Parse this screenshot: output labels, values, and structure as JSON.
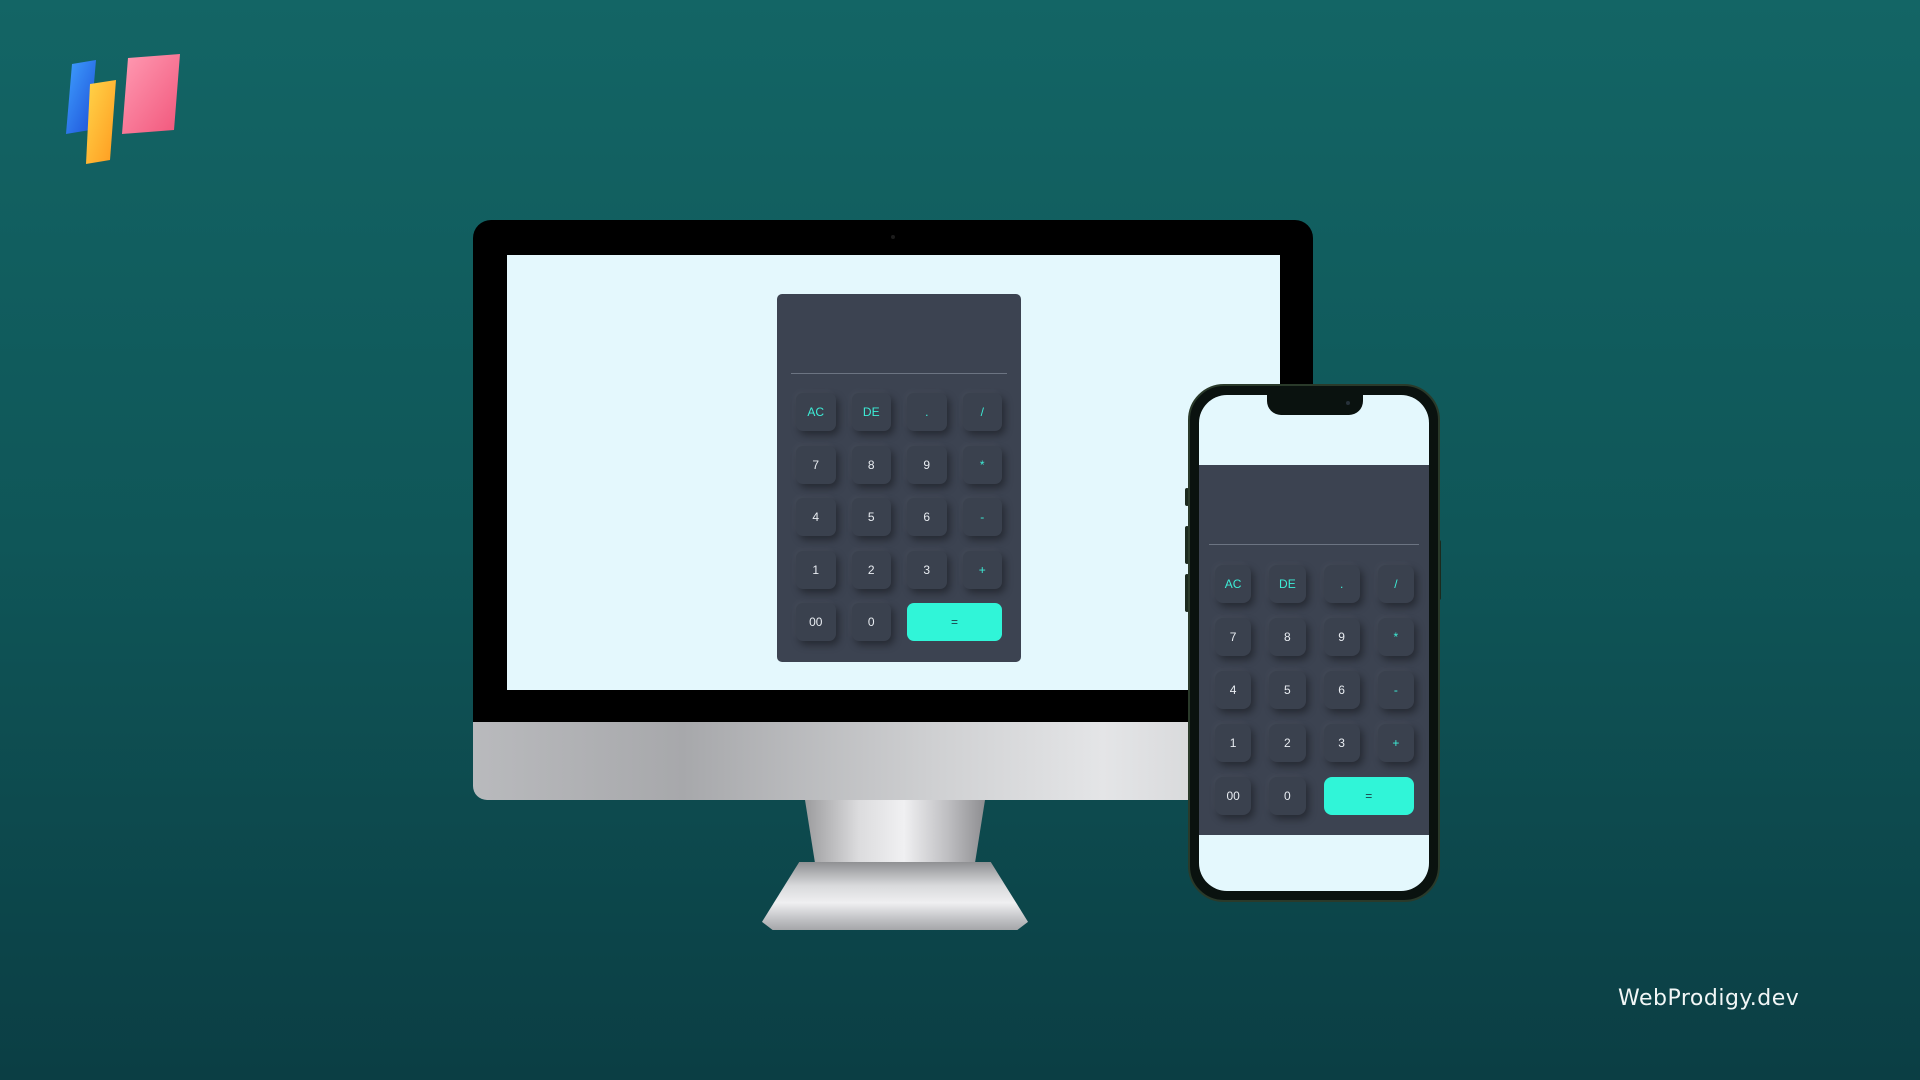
{
  "brand": {
    "watermark": "WebProdigy.dev",
    "logo_icon": "colorful-bars-logo-icon"
  },
  "colors": {
    "background_top": "#136565",
    "background_bottom": "#0b3e44",
    "calculator_body": "#3c4351",
    "operator_accent": "#3dedd7",
    "equals_button": "#30f5d8",
    "page_background": "#e4f8fd"
  },
  "calculator": {
    "display": "",
    "keys": [
      {
        "label": "AC",
        "kind": "op"
      },
      {
        "label": "DE",
        "kind": "op"
      },
      {
        "label": ".",
        "kind": "op"
      },
      {
        "label": "/",
        "kind": "op"
      },
      {
        "label": "7",
        "kind": "num"
      },
      {
        "label": "8",
        "kind": "num"
      },
      {
        "label": "9",
        "kind": "num"
      },
      {
        "label": "*",
        "kind": "op"
      },
      {
        "label": "4",
        "kind": "num"
      },
      {
        "label": "5",
        "kind": "num"
      },
      {
        "label": "6",
        "kind": "num"
      },
      {
        "label": "-",
        "kind": "op"
      },
      {
        "label": "1",
        "kind": "num"
      },
      {
        "label": "2",
        "kind": "num"
      },
      {
        "label": "3",
        "kind": "num"
      },
      {
        "label": "+",
        "kind": "op"
      },
      {
        "label": "00",
        "kind": "num"
      },
      {
        "label": "0",
        "kind": "num"
      },
      {
        "label": "=",
        "kind": "equals"
      }
    ]
  }
}
